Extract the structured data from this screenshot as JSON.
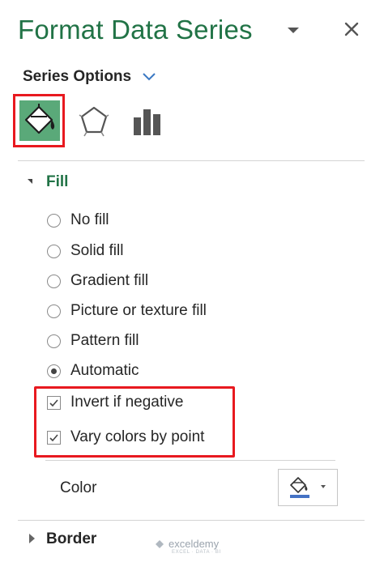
{
  "panel": {
    "title": "Format Data Series",
    "series_options_label": "Series Options"
  },
  "tabs": [
    {
      "name": "Fill & Line",
      "icon": "paint-bucket-icon",
      "selected": true
    },
    {
      "name": "Effects",
      "icon": "pentagon-icon",
      "selected": false
    },
    {
      "name": "Series Options",
      "icon": "bar-chart-icon",
      "selected": false
    }
  ],
  "fill": {
    "section_label": "Fill",
    "options": [
      {
        "label": "No fill",
        "selected": false
      },
      {
        "label": "Solid fill",
        "selected": false
      },
      {
        "label": "Gradient fill",
        "selected": false
      },
      {
        "label": "Picture or texture fill",
        "selected": false
      },
      {
        "label": "Pattern fill",
        "selected": false
      },
      {
        "label": "Automatic",
        "selected": true
      }
    ],
    "checkboxes": [
      {
        "label": "Invert if negative",
        "checked": true
      },
      {
        "label": "Vary colors by point",
        "checked": true
      }
    ],
    "color_label": "Color"
  },
  "border": {
    "section_label": "Border"
  },
  "watermark": {
    "brand": "exceldemy",
    "tagline": "EXCEL · DATA · BI"
  },
  "colors": {
    "accent_green": "#217346",
    "highlight_red": "#e8191f",
    "tab_selected_bg": "#5aa979"
  }
}
